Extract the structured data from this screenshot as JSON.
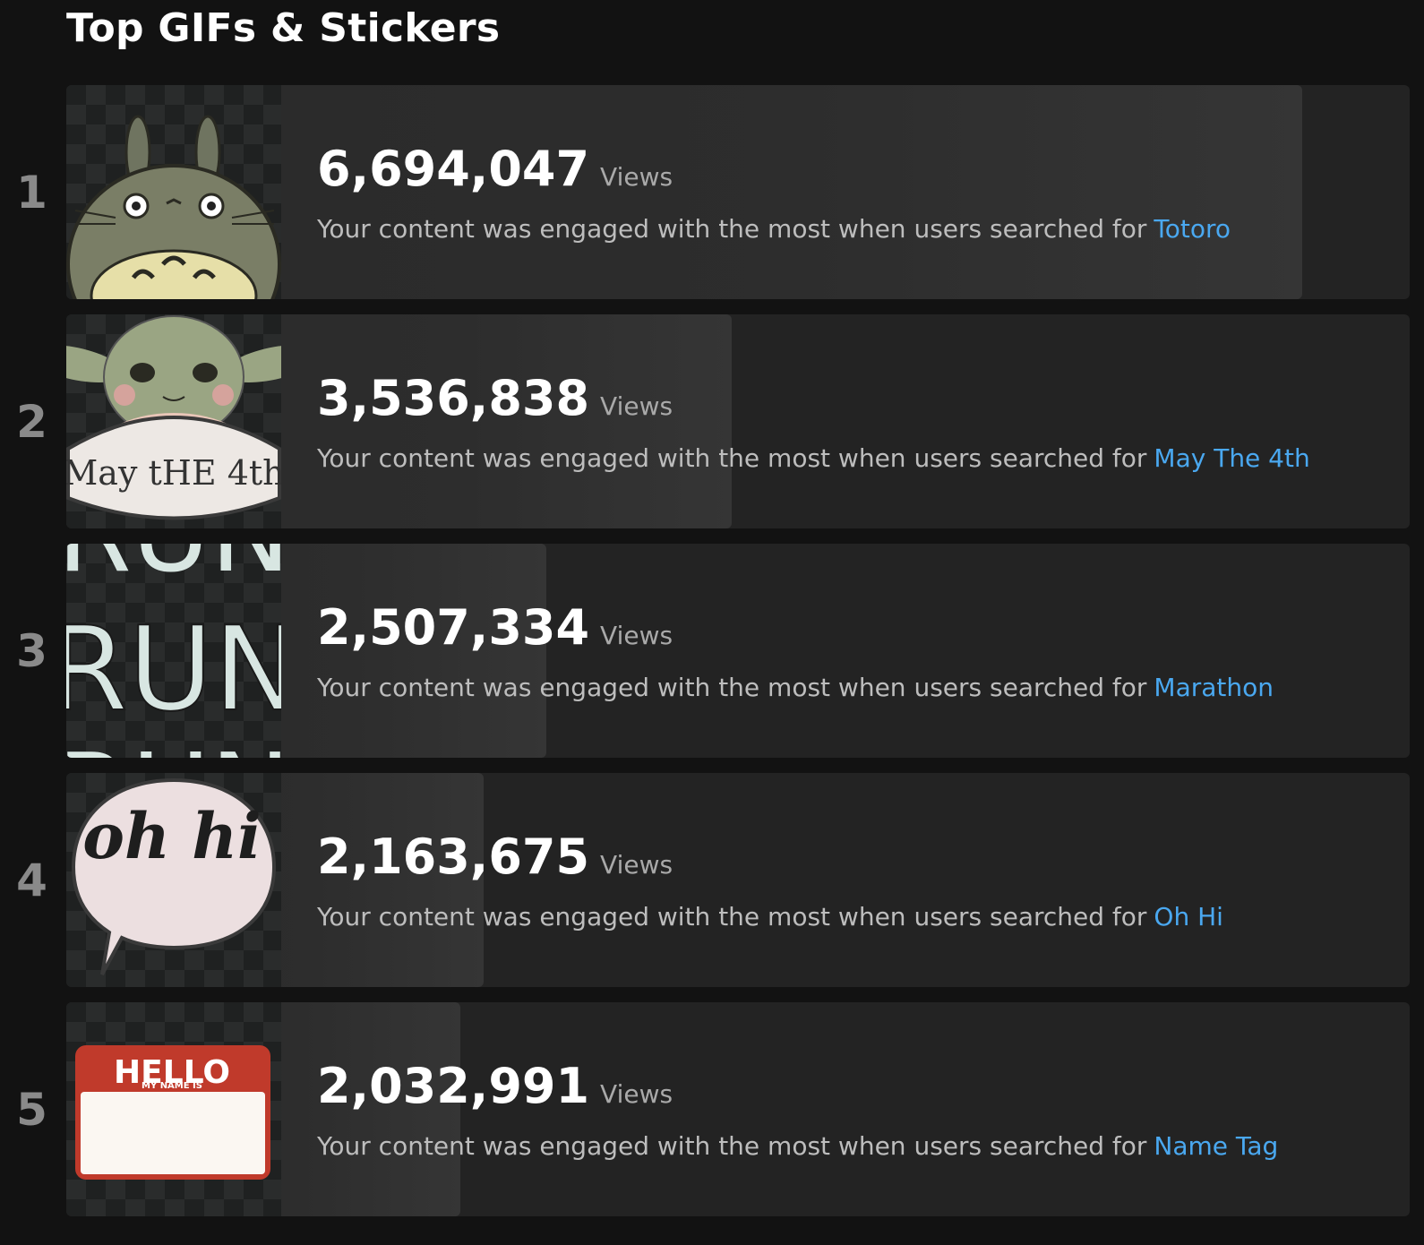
{
  "page": {
    "title": "Top GIFs & Stickers"
  },
  "colors": {
    "background": "#121212",
    "card": "#232323",
    "accent": "#4aa8f0",
    "muted": "#bdbdbd"
  },
  "items": [
    {
      "rank": "1",
      "count": "6,694,047",
      "views_label": "Views",
      "description": "Your content was engaged with the most when users searched for",
      "term": "Totoro",
      "views": 6694047,
      "thumbnail": "totoro-sticker"
    },
    {
      "rank": "2",
      "count": "3,536,838",
      "views_label": "Views",
      "description": "Your content was engaged with the most when users searched for",
      "term": "May The 4th",
      "views": 3536838,
      "thumbnail": "may-the-4th-sticker",
      "sticker_text": "May tHE 4th"
    },
    {
      "rank": "3",
      "count": "2,507,334",
      "views_label": "Views",
      "description": "Your content was engaged with the most when users searched for",
      "term": "Marathon",
      "views": 2507334,
      "thumbnail": "run-sticker",
      "sticker_text": "RUN"
    },
    {
      "rank": "4",
      "count": "2,163,675",
      "views_label": "Views",
      "description": "Your content was engaged with the most when users searched for",
      "term": "Oh Hi",
      "views": 2163675,
      "thumbnail": "oh-hi-sticker",
      "sticker_text": "oh hi"
    },
    {
      "rank": "5",
      "count": "2,032,991",
      "views_label": "Views",
      "description": "Your content was engaged with the most when users searched for",
      "term": "Name Tag",
      "views": 2032991,
      "thumbnail": "name-tag-sticker",
      "sticker_text": "HELLO",
      "sticker_subtext": "MY NAME IS"
    }
  ]
}
